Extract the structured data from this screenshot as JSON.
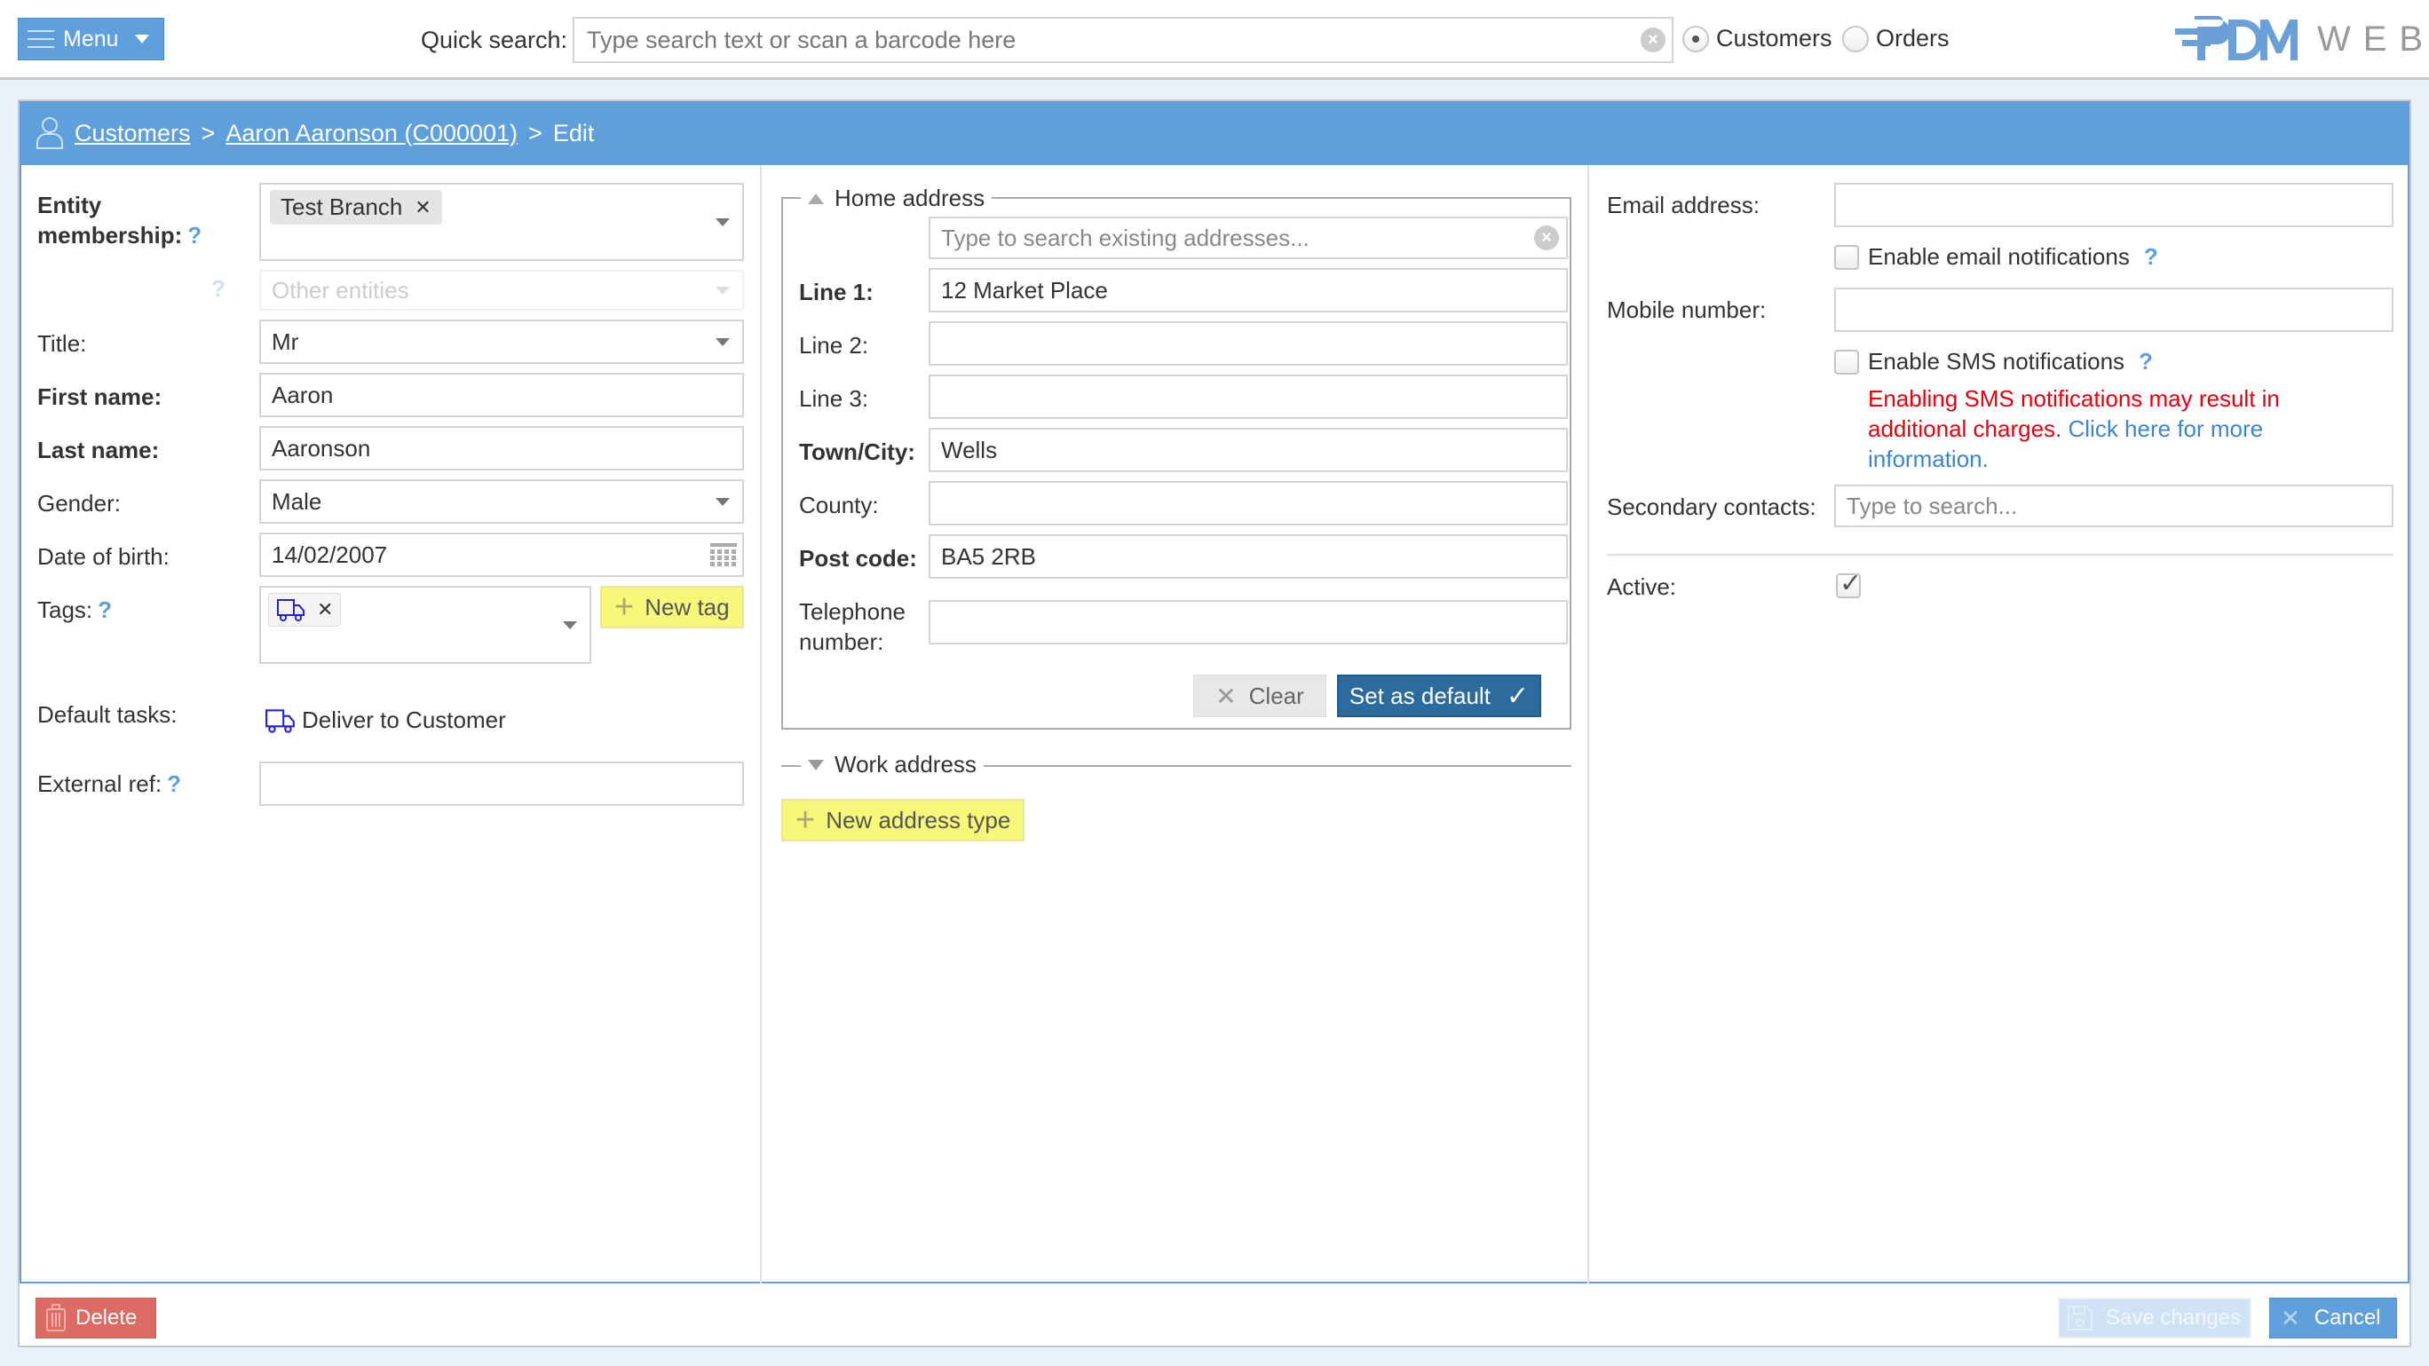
{
  "topbar": {
    "menu_label": "Menu",
    "quick_search_label": "Quick search:",
    "quick_search_placeholder": "Type search text or scan a barcode here",
    "quick_search_value": "",
    "search_scope_options": [
      {
        "label": "Customers",
        "selected": true
      },
      {
        "label": "Orders",
        "selected": false
      }
    ],
    "logo_text": "WEB",
    "logo_mark": "PDM"
  },
  "breadcrumb": {
    "items": [
      "Customers",
      "Aaron Aaronson (C000001)"
    ],
    "separator": ">",
    "current": "Edit"
  },
  "left": {
    "entity_membership_label": "Entity membership:",
    "entity_membership_chips": [
      "Test Branch"
    ],
    "other_entities_placeholder": "Other entities",
    "title_label": "Title:",
    "title_value": "Mr",
    "first_name_label": "First name:",
    "first_name_value": "Aaron",
    "last_name_label": "Last name:",
    "last_name_value": "Aaronson",
    "gender_label": "Gender:",
    "gender_value": "Male",
    "dob_label": "Date of birth:",
    "dob_value": "14/02/2007",
    "tags_label": "Tags:",
    "tags_chips": [
      {
        "icon": "truck-icon"
      }
    ],
    "new_tag_label": "New tag",
    "default_tasks_label": "Default tasks:",
    "default_tasks": [
      {
        "icon": "truck-icon",
        "label": "Deliver to Customer"
      }
    ],
    "external_ref_label": "External ref:",
    "external_ref_value": ""
  },
  "address": {
    "home_legend": "Home address",
    "search_placeholder": "Type to search existing addresses...",
    "line1_label": "Line 1:",
    "line1_value": "12 Market Place",
    "line2_label": "Line 2:",
    "line2_value": "",
    "line3_label": "Line 3:",
    "line3_value": "",
    "town_label": "Town/City:",
    "town_value": "Wells",
    "county_label": "County:",
    "county_value": "",
    "postcode_label": "Post code:",
    "postcode_value": "BA5 2RB",
    "telephone_label": "Telephone number:",
    "telephone_value": "",
    "clear_label": "Clear",
    "set_default_label": "Set as default",
    "work_legend": "Work address",
    "new_address_type_label": "New address type"
  },
  "contact": {
    "email_label": "Email address:",
    "email_value": "",
    "email_notify_label": "Enable email notifications",
    "email_notify_checked": false,
    "mobile_label": "Mobile number:",
    "mobile_value": "",
    "sms_notify_label": "Enable SMS notifications",
    "sms_notify_checked": false,
    "sms_warning": "Enabling SMS notifications may result in additional charges.",
    "sms_more_link": "Click here for more information.",
    "secondary_label": "Secondary contacts:",
    "secondary_placeholder": "Type to search...",
    "active_label": "Active:",
    "active_checked": true
  },
  "footer": {
    "delete_label": "Delete",
    "save_label": "Save changes",
    "save_enabled": false,
    "cancel_label": "Cancel"
  },
  "colors": {
    "accent": "#5fa0dc",
    "primary_dark": "#2c6b9e",
    "danger": "#dc6b63",
    "warning_text": "#e8000e",
    "link": "#3b86cc",
    "highlight_yellow": "#f7f77a"
  }
}
